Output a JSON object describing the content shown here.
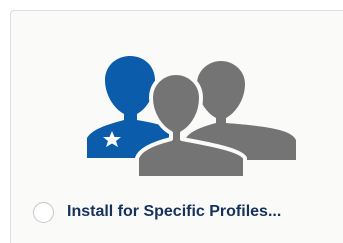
{
  "option": {
    "label": "Install for Specific Profiles...",
    "selected": false
  },
  "illustration": {
    "icon": "user-group-icon",
    "accent_color": "#0b5cab",
    "secondary_color": "#747474",
    "badge_icon": "star-icon"
  },
  "colors": {
    "card_background": "#fafaf9",
    "card_border": "#d8dde6",
    "label_text": "#16325c",
    "radio_border": "#c9c7c5"
  }
}
